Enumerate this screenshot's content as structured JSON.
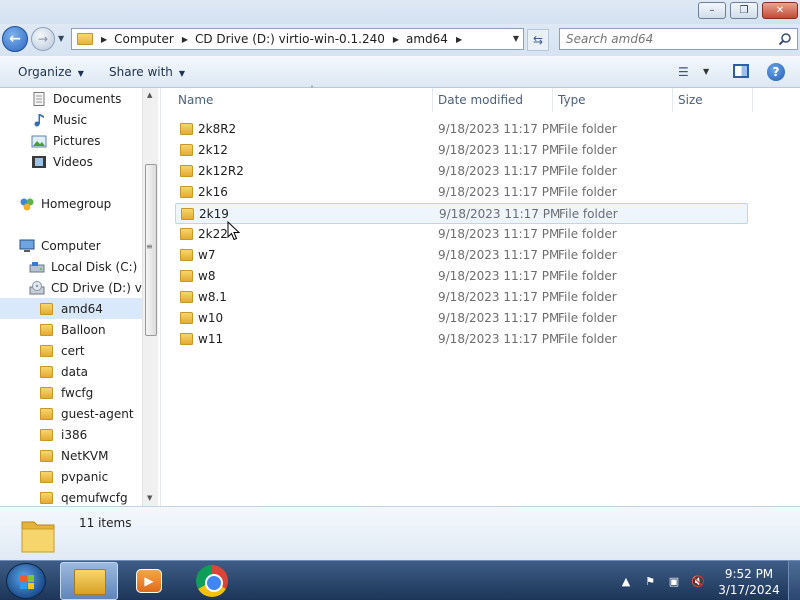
{
  "window": {
    "minimize_glyph": "–",
    "maximize_glyph": "❐",
    "close_glyph": "✕"
  },
  "address": {
    "crumbs": [
      "Computer",
      "CD Drive (D:) virtio-win-0.1.240",
      "amd64"
    ],
    "search_placeholder": "Search amd64"
  },
  "commandbar": {
    "organize": "Organize",
    "share_with": "Share with"
  },
  "navigation": {
    "items": [
      {
        "label": "Documents",
        "icon": "documents-icon"
      },
      {
        "label": "Music",
        "icon": "music-icon"
      },
      {
        "label": "Pictures",
        "icon": "pictures-icon"
      },
      {
        "label": "Videos",
        "icon": "videos-icon"
      },
      {
        "label": "Homegroup",
        "icon": "homegroup-icon"
      },
      {
        "label": "Computer",
        "icon": "computer-icon"
      },
      {
        "label": "Local Disk (C:)",
        "icon": "local-disk-icon"
      },
      {
        "label": "CD Drive (D:) virt",
        "icon": "cd-drive-icon"
      },
      {
        "label": "amd64",
        "icon": "folder-icon",
        "selected": true
      },
      {
        "label": "Balloon",
        "icon": "folder-icon"
      },
      {
        "label": "cert",
        "icon": "folder-icon"
      },
      {
        "label": "data",
        "icon": "folder-icon"
      },
      {
        "label": "fwcfg",
        "icon": "folder-icon"
      },
      {
        "label": "guest-agent",
        "icon": "folder-icon"
      },
      {
        "label": "i386",
        "icon": "folder-icon"
      },
      {
        "label": "NetKVM",
        "icon": "folder-icon"
      },
      {
        "label": "pvpanic",
        "icon": "folder-icon"
      },
      {
        "label": "qemufwcfg",
        "icon": "folder-icon"
      }
    ]
  },
  "filelist": {
    "columns": [
      "Name",
      "Date modified",
      "Type",
      "Size"
    ],
    "rows": [
      {
        "name": "2k8R2",
        "date": "9/18/2023 11:17 PM",
        "type": "File folder"
      },
      {
        "name": "2k12",
        "date": "9/18/2023 11:17 PM",
        "type": "File folder"
      },
      {
        "name": "2k12R2",
        "date": "9/18/2023 11:17 PM",
        "type": "File folder"
      },
      {
        "name": "2k16",
        "date": "9/18/2023 11:17 PM",
        "type": "File folder"
      },
      {
        "name": "2k19",
        "date": "9/18/2023 11:17 PM",
        "type": "File folder",
        "hovered": true
      },
      {
        "name": "2k22",
        "date": "9/18/2023 11:17 PM",
        "type": "File folder"
      },
      {
        "name": "w7",
        "date": "9/18/2023 11:17 PM",
        "type": "File folder"
      },
      {
        "name": "w8",
        "date": "9/18/2023 11:17 PM",
        "type": "File folder"
      },
      {
        "name": "w8.1",
        "date": "9/18/2023 11:17 PM",
        "type": "File folder"
      },
      {
        "name": "w10",
        "date": "9/18/2023 11:17 PM",
        "type": "File folder"
      },
      {
        "name": "w11",
        "date": "9/18/2023 11:17 PM",
        "type": "File folder"
      }
    ]
  },
  "details": {
    "item_count": "11 items"
  },
  "taskbar": {
    "time": "9:52 PM",
    "date": "3/17/2024"
  },
  "colors": {
    "selection": "#d9e8fa",
    "hover_border": "#b8d6fb",
    "taskbar": "#1d3558"
  }
}
